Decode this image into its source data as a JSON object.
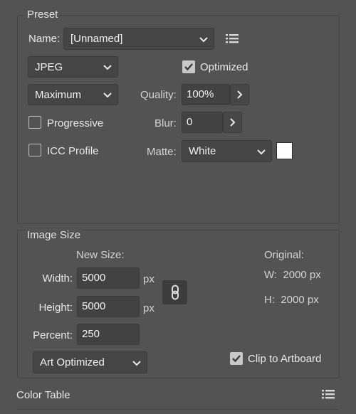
{
  "preset": {
    "group_label": "Preset",
    "name_label": "Name:",
    "name_value": "[Unnamed]",
    "format_value": "JPEG",
    "optimized_label": "Optimized",
    "optimized_checked": true,
    "compression_value": "Maximum",
    "quality_label": "Quality:",
    "quality_value": "100%",
    "progressive_label": "Progressive",
    "progressive_checked": false,
    "blur_label": "Blur:",
    "blur_value": "0",
    "icc_label": "ICC Profile",
    "icc_checked": false,
    "matte_label": "Matte:",
    "matte_value": "White",
    "matte_color": "#ffffff"
  },
  "image_size": {
    "group_label": "Image Size",
    "new_size_label": "New Size:",
    "width_label": "Width:",
    "width_value": "5000",
    "height_label": "Height:",
    "height_value": "5000",
    "unit": "px",
    "percent_label": "Percent:",
    "percent_value": "250",
    "resample_value": "Art Optimized",
    "original_label": "Original:",
    "orig_w": "W:  2000 px",
    "orig_h": "H:  2000 px",
    "clip_label": "Clip to Artboard",
    "clip_checked": true,
    "link_icon": "link-icon"
  },
  "color_table": {
    "label": "Color Table",
    "menu_icon": "list-menu-icon"
  },
  "colors": {
    "panel_bg": "#535353",
    "field_bg": "#424242",
    "text": "#e8e8e8"
  }
}
